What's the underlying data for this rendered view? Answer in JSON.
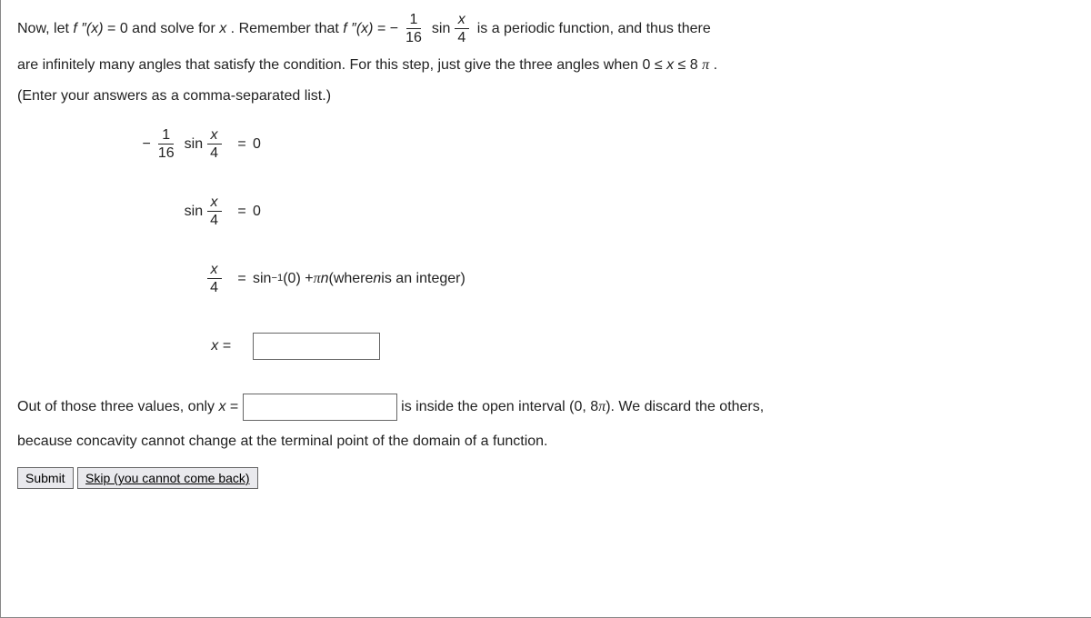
{
  "problem": {
    "p1_a": "Now, let ",
    "p1_b": " = 0 and solve for ",
    "p1_c": ". Remember that ",
    "p1_d": " = ",
    "p1_e": " is a periodic function, and thus there",
    "p2_a": "are infinitely many angles that satisfy the condition. For this step, just give the three angles when 0 ≤ ",
    "p2_b": " ≤ 8",
    "p2_c": ".",
    "p3": "(Enter your answers as a comma-separated list.)",
    "fpp": "f ″(x)",
    "x": "x",
    "minus": "−",
    "sin": "sin",
    "n1": "1",
    "n16": "16",
    "n4": "4",
    "zero": "0",
    "eq": "=",
    "step3_rhs_a": "sin",
    "step3_rhs_sup": "−1",
    "step3_rhs_b": "(0) + ",
    "step3_rhs_c": "n",
    "step3_rhs_d": " (where ",
    "step3_rhs_e": "n",
    "step3_rhs_f": " is an integer)",
    "xeq": "x =",
    "out1_a": "Out of those three values, only ",
    "out1_b": " = ",
    "out1_c": " is inside the open interval (0, 8",
    "out1_d": "). We discard the others,",
    "out2": "because concavity cannot change at the terminal point of the domain of a function.",
    "pi": "π"
  },
  "inputs": {
    "answer_x": "",
    "answer_interval": ""
  },
  "buttons": {
    "submit": "Submit",
    "skip": "Skip (you cannot come back)"
  }
}
